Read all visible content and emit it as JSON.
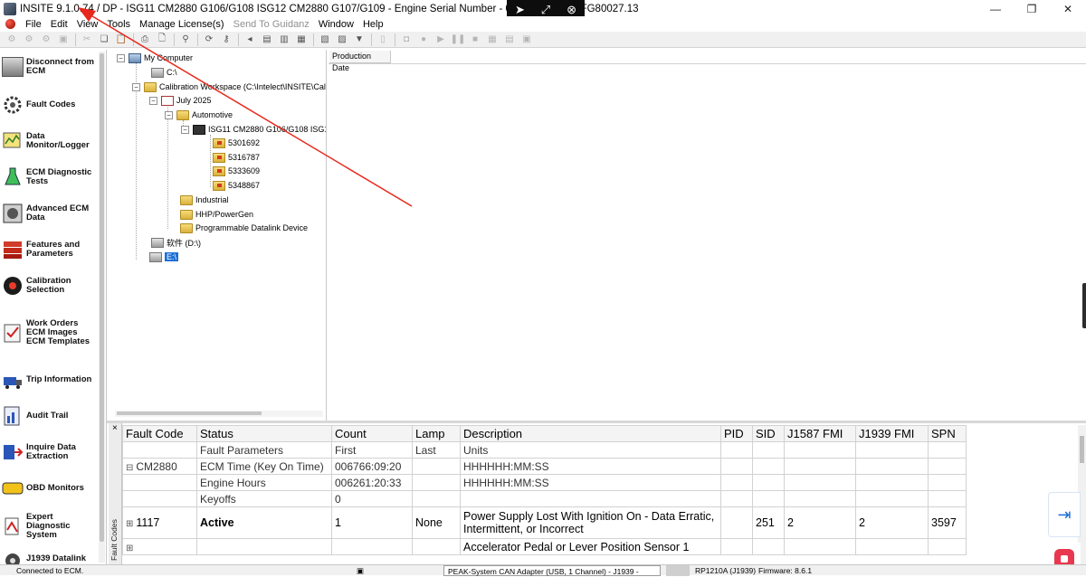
{
  "window": {
    "title": "INSITE 9.1.0.74  / DP - ISG11 CM2880 G106/G108 ISG12 CM2880 G107/G109 - Engine Serial Number - 0 - ECM Code - FG80027.13"
  },
  "menu": {
    "items": [
      {
        "label": "File",
        "enabled": true
      },
      {
        "label": "Edit",
        "enabled": true
      },
      {
        "label": "View",
        "enabled": true
      },
      {
        "label": "Tools",
        "enabled": true
      },
      {
        "label": "Manage License(s)",
        "enabled": true
      },
      {
        "label": "Send To Guidanz",
        "enabled": false
      },
      {
        "label": "Window",
        "enabled": true
      },
      {
        "label": "Help",
        "enabled": true
      }
    ]
  },
  "nav": {
    "items": [
      {
        "label": "Disconnect from\nECM",
        "icon": "disconnect-icon"
      },
      {
        "label": "Fault Codes",
        "icon": "fault-codes-icon"
      },
      {
        "label": "Data\nMonitor/Logger",
        "icon": "data-monitor-icon"
      },
      {
        "label": "ECM Diagnostic\nTests",
        "icon": "diagnostic-tests-icon"
      },
      {
        "label": "Advanced ECM\nData",
        "icon": "advanced-data-icon"
      },
      {
        "label": "Features and\nParameters",
        "icon": "features-icon"
      },
      {
        "label": "Calibration\nSelection",
        "icon": "calibration-icon"
      },
      {
        "label": "Work Orders\nECM Images\nECM Templates",
        "icon": "work-orders-icon"
      },
      {
        "label": "Trip Information",
        "icon": "trip-icon"
      },
      {
        "label": "Audit Trail",
        "icon": "audit-icon"
      },
      {
        "label": "Inquire Data\nExtraction",
        "icon": "inquire-icon"
      },
      {
        "label": "OBD Monitors",
        "icon": "obd-icon"
      },
      {
        "label": "Expert\nDiagnostic\nSystem",
        "icon": "expert-icon"
      },
      {
        "label": "J1939 Datalink",
        "icon": "j1939-icon"
      }
    ]
  },
  "tree": {
    "my_computer": "My Computer",
    "drive_c": "C:\\",
    "workspace": "Calibration Workspace  (C:\\Intelect\\INSITE\\Cal",
    "month": "July 2025",
    "automotive": "Automotive",
    "engine": "ISG11 CM2880 G106/G108 ISG12",
    "files": [
      "5301692",
      "5316787",
      "5333609",
      "5348867"
    ],
    "industrial": "Industrial",
    "hhp": "HHP/PowerGen",
    "programmable": "Programmable Datalink Device",
    "drive_d": "软件  (D:\\)",
    "drive_e": "E:\\"
  },
  "right_pane": {
    "column_header": "Production Date"
  },
  "fault_panel": {
    "side_label": "Fault Codes",
    "close": "×",
    "headers": [
      "Fault Code",
      "Status",
      "Count",
      "Lamp",
      "Description",
      "PID",
      "SID",
      "J1587 FMI",
      "J1939 FMI",
      "SPN"
    ],
    "subheaders": [
      "",
      "Fault Parameters",
      "First",
      "Last",
      "Units",
      "",
      "",
      "",
      "",
      ""
    ],
    "rows": [
      {
        "code": "CM2880",
        "status": "ECM Time (Key On Time)",
        "count": "006766:09:20",
        "lamp": "",
        "desc": "HHHHHH:MM:SS",
        "pid": "",
        "sid": "",
        "j1587": "",
        "j1939": "",
        "spn": ""
      },
      {
        "code": "",
        "status": "Engine Hours",
        "count": "006261:20:33",
        "lamp": "",
        "desc": "HHHHHH:MM:SS",
        "pid": "",
        "sid": "",
        "j1587": "",
        "j1939": "",
        "spn": ""
      },
      {
        "code": "",
        "status": "Keyoffs",
        "count": "0",
        "lamp": "",
        "desc": "",
        "pid": "",
        "sid": "",
        "j1587": "",
        "j1939": "",
        "spn": ""
      },
      {
        "code": "1117",
        "status": "Active",
        "count": "1",
        "lamp": "None",
        "desc": "Power Supply Lost With Ignition On - Data Erratic, Intermittent, or Incorrect",
        "pid": "",
        "sid": "251",
        "j1587": "2",
        "j1939": "2",
        "spn": "3597"
      },
      {
        "code": "",
        "status": "",
        "count": "",
        "lamp": "",
        "desc": "Accelerator Pedal or Lever Position Sensor 1",
        "pid": "",
        "sid": "",
        "j1587": "",
        "j1939": "",
        "spn": ""
      }
    ]
  },
  "status_bar": {
    "connection": "Connected to ECM.",
    "adapter": "PEAK-System CAN Adapter (USB, 1 Channel) - J1939 -",
    "protocol": "RP1210A (J1939)",
    "firmware": "Firmware: 8.6.1"
  },
  "colors": {
    "annotation_arrow": "#e8281c",
    "accent_blue": "#1e6fd6"
  }
}
